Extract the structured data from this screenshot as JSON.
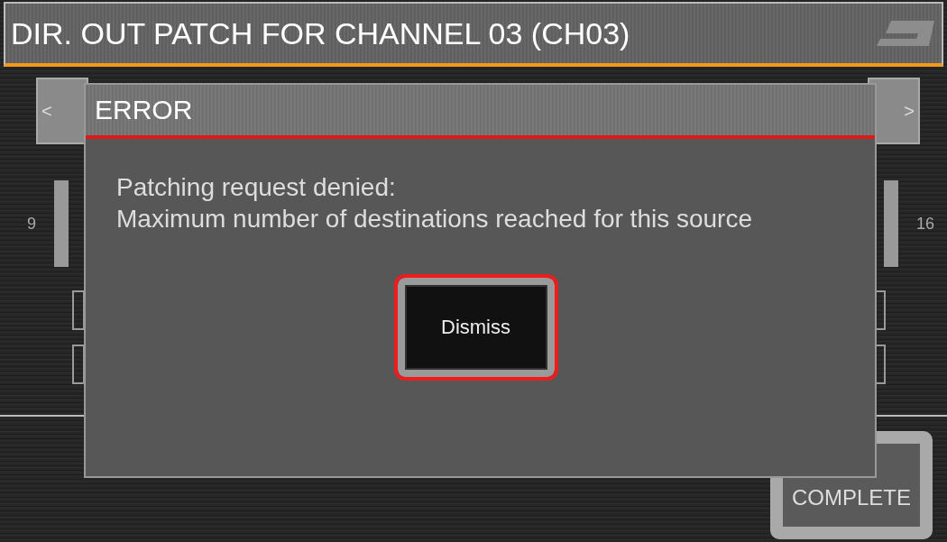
{
  "window": {
    "title": "DIR. OUT PATCH FOR CHANNEL 03 (CH03)"
  },
  "nav": {
    "prev": "<",
    "next": ">"
  },
  "channel_range": {
    "start": "9",
    "end": "16"
  },
  "complete_button": {
    "label": "COMPLETE"
  },
  "dialog": {
    "title": "ERROR",
    "message": "Patching request denied:\nMaximum number of destinations reached for this source",
    "buttons": [
      {
        "label": "Dismiss",
        "selected": true
      }
    ]
  }
}
